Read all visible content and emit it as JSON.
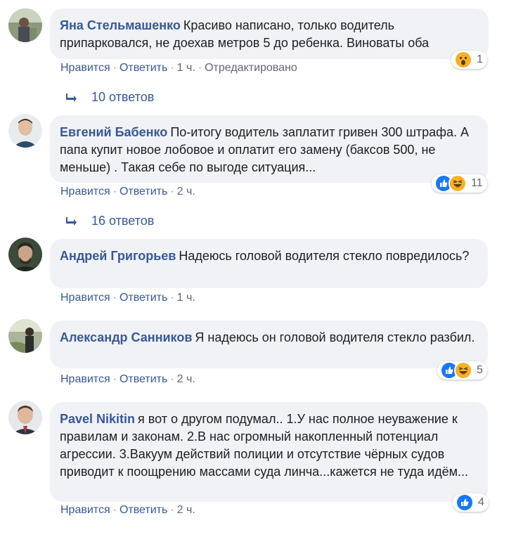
{
  "comments": [
    {
      "author": "Яна Стельмашенко",
      "text": "Красиво написано, только водитель припарковался, не доехав метров 5 до ребенка. Виноваты оба",
      "like_label": "Нравится",
      "reply_label": "Ответить",
      "time": "1 ч.",
      "edited": "Отредактировано",
      "reactions": [
        "wow"
      ],
      "reaction_count": "1",
      "replies": "10 ответов"
    },
    {
      "author": "Евгений Бабенко",
      "text": "По-итогу водитель заплатит гривен 300 штрафа. А папа купит новое лобовое и оплатит его замену (баксов 500, не меньше) . Такая себе по выгоде ситуация...",
      "like_label": "Нравится",
      "reply_label": "Ответить",
      "time": "2 ч.",
      "reactions": [
        "like",
        "haha"
      ],
      "reaction_count": "11",
      "replies": "16 ответов"
    },
    {
      "author": "Андрей Григорьев",
      "text": "Надеюсь головой водителя стекло повредилось?",
      "like_label": "Нравится",
      "reply_label": "Ответить",
      "time": "1 ч."
    },
    {
      "author": "Александр Санников",
      "text": "Я надеюсь он головой водителя стекло разбил.",
      "like_label": "Нравится",
      "reply_label": "Ответить",
      "time": "2 ч.",
      "reactions": [
        "like",
        "haha"
      ],
      "reaction_count": "5"
    },
    {
      "author": "Pavel Nikitin",
      "text": "я вот о другом подумал.. 1.У нас полное неуважение к правилам и законам. 2.В нас огромный накопленный потенциал агрессии. 3.Вакуум действий полиции и отсутствие чёрных судов приводит к поощрению массами суда линча...кажется не туда идём...",
      "like_label": "Нравится",
      "reply_label": "Ответить",
      "time": "2 ч.",
      "reactions": [
        "like"
      ],
      "reaction_count": "4"
    }
  ],
  "colors": {
    "link": "#385898",
    "bubble": "#f0f2f5",
    "like": "#1877f2",
    "haha": "#f7b125"
  }
}
